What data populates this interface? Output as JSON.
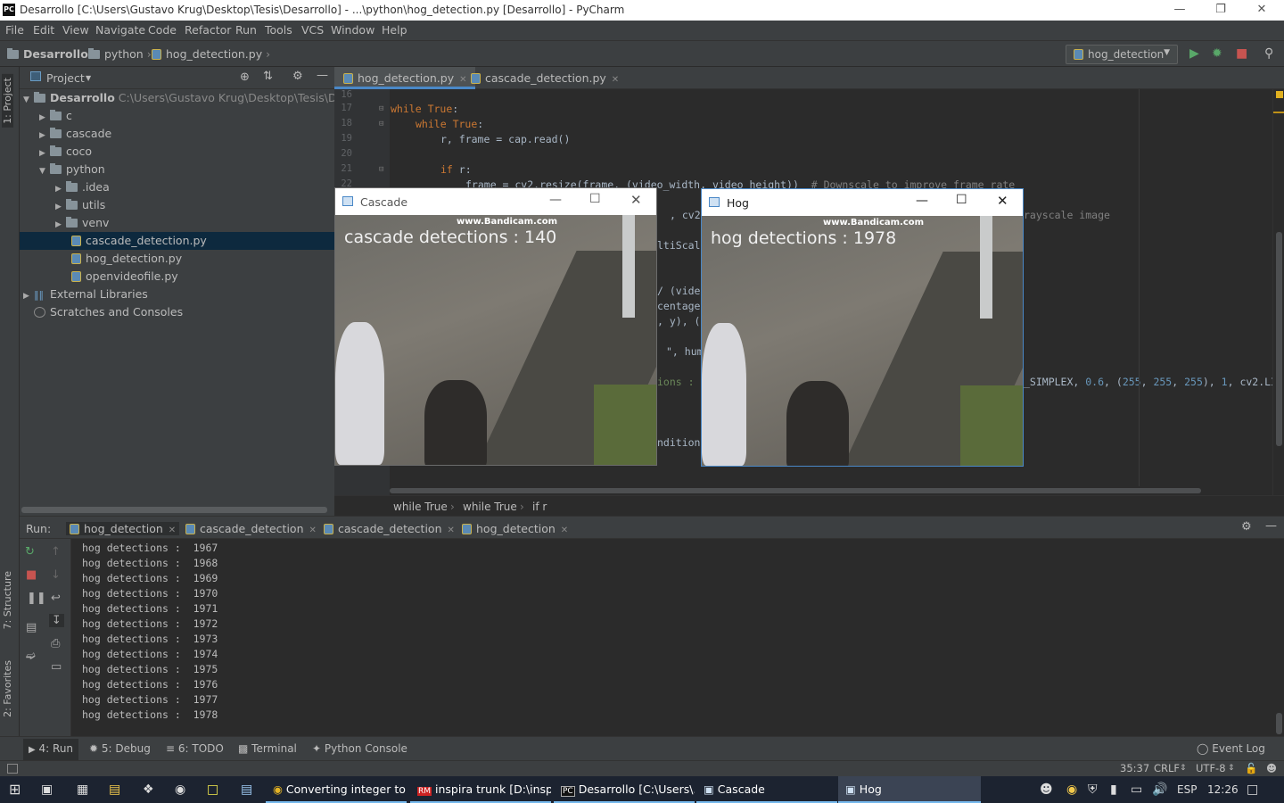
{
  "window": {
    "title": "Desarrollo [C:\\Users\\Gustavo Krug\\Desktop\\Tesis\\Desarrollo] - ...\\python\\hog_detection.py [Desarrollo] - PyCharm",
    "logo": "PC"
  },
  "menu": [
    "File",
    "Edit",
    "View",
    "Navigate",
    "Code",
    "Refactor",
    "Run",
    "Tools",
    "VCS",
    "Window",
    "Help"
  ],
  "nav": {
    "crumbs": [
      "Desarrollo",
      "python",
      "hog_detection.py"
    ],
    "run_config": "hog_detection"
  },
  "left_strip": {
    "project": "1: Project",
    "structure": "7: Structure",
    "favorites": "2: Favorites"
  },
  "project": {
    "header": "Project",
    "root_name": "Desarrollo",
    "root_path": "C:\\Users\\Gustavo Krug\\Desktop\\Tesis\\Desarrollo",
    "items": [
      "c",
      "cascade",
      "coco",
      "python",
      ".idea",
      "utils",
      "venv",
      "cascade_detection.py",
      "hog_detection.py",
      "openvideofile.py",
      "External Libraries",
      "Scratches and Consoles"
    ]
  },
  "editor": {
    "tabs": [
      "hog_detection.py",
      "cascade_detection.py"
    ],
    "line_numbers": [
      "16",
      "17",
      "18",
      "19",
      "20",
      "21",
      "22"
    ],
    "code": {
      "l17_kw": "while",
      "l17_val": "True",
      "l17_colon": ":",
      "l18_kw": "while",
      "l18_val": "True",
      "l18_colon": ":",
      "l19": "r, frame = cap.read()",
      "l21_kw": "if",
      "l21_rest": " r:",
      "l22": "frame = cv2.resize(frame, (video_width, video_height))",
      "l22_comment": "# Downscale to improve frame rate",
      "frag1": ", cv2.",
      "frag1_comment": "rayscale image",
      "frag2": "ltiScal",
      "frag3": "/ (vide",
      "frag4": "centage",
      "frag5": ", y), (",
      "frag6": "\", hum",
      "frag7_pre": "ions : ",
      "frag7_a": "_SIMPLEX, ",
      "frag7_n1": "0.6",
      "frag7_b": ", (",
      "frag7_n2": "255",
      "frag7_n3": "255",
      "frag7_n4": "255",
      "frag7_c": "), ",
      "frag7_n5": "1",
      "frag7_d": ", cv2.LI",
      "frag8": "ndition"
    },
    "breadcrumbs": [
      "while True",
      "while True",
      "if r"
    ]
  },
  "cv_windows": {
    "cascade": {
      "title": "Cascade",
      "overlay": "cascade detections : 140",
      "watermark": "www.Bandicam.com"
    },
    "hog": {
      "title": "Hog",
      "overlay": "hog detections : 1978",
      "watermark": "www.Bandicam.com"
    }
  },
  "run": {
    "label": "Run:",
    "tabs": [
      "hog_detection",
      "cascade_detection",
      "cascade_detection",
      "hog_detection"
    ],
    "output": [
      "hog detections :  1967",
      "hog detections :  1968",
      "hog detections :  1969",
      "hog detections :  1970",
      "hog detections :  1971",
      "hog detections :  1972",
      "hog detections :  1973",
      "hog detections :  1974",
      "hog detections :  1975",
      "hog detections :  1976",
      "hog detections :  1977",
      "hog detections :  1978"
    ]
  },
  "bottom_tabs": {
    "run": "4: Run",
    "debug": "5: Debug",
    "todo": "6: TODO",
    "terminal": "Terminal",
    "python_console": "Python Console",
    "event_log": "Event Log"
  },
  "status": {
    "position": "35:37",
    "line_sep": "CRLF",
    "encoding": "UTF-8"
  },
  "taskbar": {
    "items": [
      "Converting integer to...",
      "inspira trunk [D:\\inspi...",
      "Desarrollo [C:\\Users\\...",
      "Cascade",
      "Hog"
    ],
    "lang": "ESP",
    "time": "12:26"
  },
  "colors": {
    "accent": "#4a88c7",
    "keyword": "#cc7832",
    "number": "#6897bb",
    "comment": "#808080",
    "run_green": "#59a869",
    "stop_red": "#c75450"
  }
}
